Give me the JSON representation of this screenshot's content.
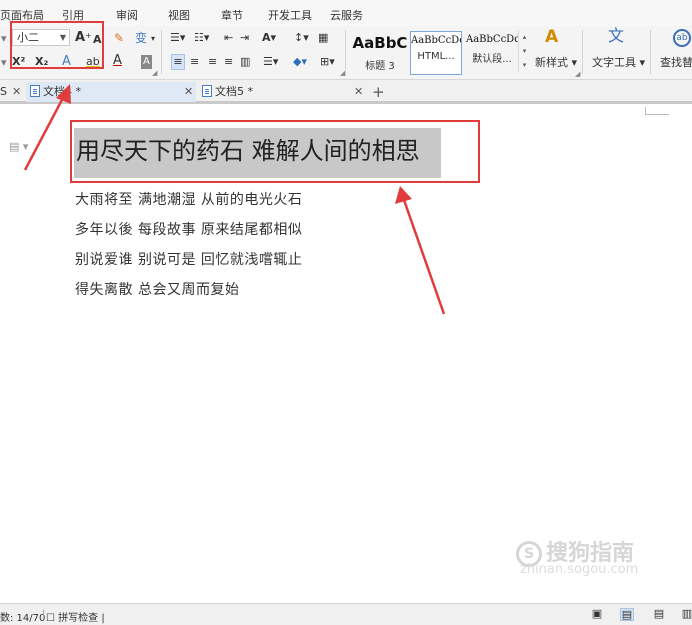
{
  "menu": {
    "tabs": [
      "页面布局",
      "引用",
      "审阅",
      "视图",
      "章节",
      "开发工具",
      "云服务"
    ]
  },
  "ribbon": {
    "font_size": "小二",
    "grow_font": "A",
    "shrink_font": "A",
    "clear_format": "✎",
    "phonetic": "变",
    "superscript": "X²",
    "subscript": "X₂",
    "font_effect": "A",
    "highlight": "ab",
    "font_color": "A",
    "char_shading": "A",
    "styles": [
      {
        "sample": "AaBbC",
        "name": "标题 3"
      },
      {
        "sample": "AaBbCcDd",
        "name": "HTML..."
      },
      {
        "sample": "AaBbCcDd",
        "name": "默认段..."
      }
    ],
    "new_style": "新样式",
    "text_tools": "文字工具",
    "find_replace": "查找替"
  },
  "doc_tabs": [
    {
      "label": "S"
    },
    {
      "label": "文档4 *"
    },
    {
      "label": "文档5 *"
    }
  ],
  "new_tab": "+",
  "document": {
    "heading": "用尽天下的药石 难解人间的相思",
    "lines": [
      "大雨将至 满地潮湿 从前的电光火石",
      "多年以後 每段故事 原来结尾都相似",
      "别说爱谁 别说可是 回忆就浅嚐辄止",
      "得失离散 总会又周而复始"
    ]
  },
  "watermark": {
    "brand": "搜狗指南",
    "url": "zhinan.sogou.com"
  },
  "status": {
    "word_count": "数: 14/70",
    "spell_check": "拼写检查"
  },
  "colors": {
    "annotation_red": "#e03c3c",
    "heading_highlight": "#c8c8c8",
    "accent_blue": "#4a7cc2"
  }
}
